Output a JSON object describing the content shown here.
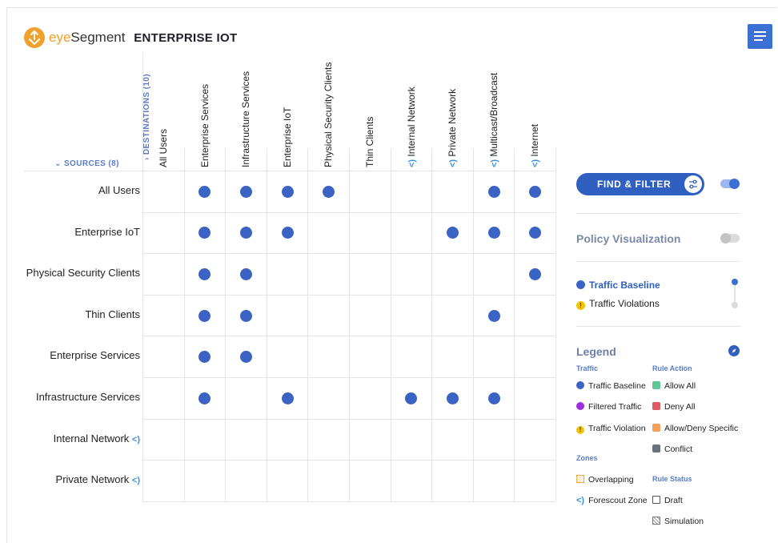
{
  "header": {
    "brand_eye": "eye",
    "brand_segment": "Segment",
    "title": "ENTERPRISE IOT"
  },
  "matrix": {
    "destinations_heading": "DESTINATIONS (10)",
    "sources_heading": "SOURCES (8)",
    "zone_glyph": "<)",
    "columns": [
      {
        "label": "All Users",
        "zone": false
      },
      {
        "label": "Enterprise Services",
        "zone": false
      },
      {
        "label": "Infrastructure Services",
        "zone": false
      },
      {
        "label": "Enterprise IoT",
        "zone": false
      },
      {
        "label": "Physical Security Clients",
        "zone": false
      },
      {
        "label": "Thin Clients",
        "zone": false
      },
      {
        "label": "Internal Network",
        "zone": true
      },
      {
        "label": "Private Network",
        "zone": true
      },
      {
        "label": "Multicast/Broadcast",
        "zone": true
      },
      {
        "label": "Internet",
        "zone": true
      }
    ],
    "rows": [
      {
        "label": "All Users",
        "zone": false,
        "cells": [
          0,
          1,
          1,
          1,
          1,
          0,
          0,
          0,
          1,
          1
        ]
      },
      {
        "label": "Enterprise IoT",
        "zone": false,
        "cells": [
          0,
          1,
          1,
          1,
          0,
          0,
          0,
          1,
          1,
          1
        ]
      },
      {
        "label": "Physical Security Clients",
        "zone": false,
        "cells": [
          0,
          1,
          1,
          0,
          0,
          0,
          0,
          0,
          0,
          1
        ]
      },
      {
        "label": "Thin Clients",
        "zone": false,
        "cells": [
          0,
          1,
          1,
          0,
          0,
          0,
          0,
          0,
          1,
          0
        ]
      },
      {
        "label": "Enterprise Services",
        "zone": false,
        "cells": [
          0,
          1,
          1,
          0,
          0,
          0,
          0,
          0,
          0,
          0
        ]
      },
      {
        "label": "Infrastructure Services",
        "zone": false,
        "cells": [
          0,
          1,
          0,
          1,
          0,
          0,
          1,
          1,
          1,
          0
        ]
      },
      {
        "label": "Internal Network",
        "zone": true,
        "cells": [
          0,
          0,
          0,
          0,
          0,
          0,
          0,
          0,
          0,
          0
        ]
      },
      {
        "label": "Private Network",
        "zone": true,
        "cells": [
          0,
          0,
          0,
          0,
          0,
          0,
          0,
          0,
          0,
          0
        ]
      }
    ]
  },
  "panel": {
    "find_filter_label": "FIND & FILTER",
    "find_filter_toggle_on": true,
    "policy_visualization_label": "Policy Visualization",
    "policy_visualization_on": false,
    "traffic_baseline_label": "Traffic Baseline",
    "traffic_violations_label": "Traffic Violations"
  },
  "legend": {
    "title": "Legend",
    "traffic_heading": "Traffic",
    "rule_action_heading": "Rule Action",
    "zones_heading": "Zones",
    "rule_status_heading": "Rule Status",
    "traffic_baseline": "Traffic Baseline",
    "filtered_traffic": "Filtered Traffic",
    "traffic_violation": "Traffic Violation",
    "allow_all": "Allow All",
    "deny_all": "Deny All",
    "allow_deny_specific": "Allow/Deny Specific",
    "conflict": "Conflict",
    "overlapping": "Overlapping",
    "forescout_zone": "Forescout Zone",
    "draft": "Draft",
    "simulation": "Simulation"
  },
  "colors": {
    "accent": "#2f5fc1",
    "dot": "#3b63c4",
    "brand_orange": "#f0a02d",
    "filtered": "#9b2fe0",
    "violation": "#f2c400",
    "allow": "#5fc79a",
    "deny": "#de5b63",
    "specific": "#f2a05b",
    "conflict": "#6b7176"
  }
}
